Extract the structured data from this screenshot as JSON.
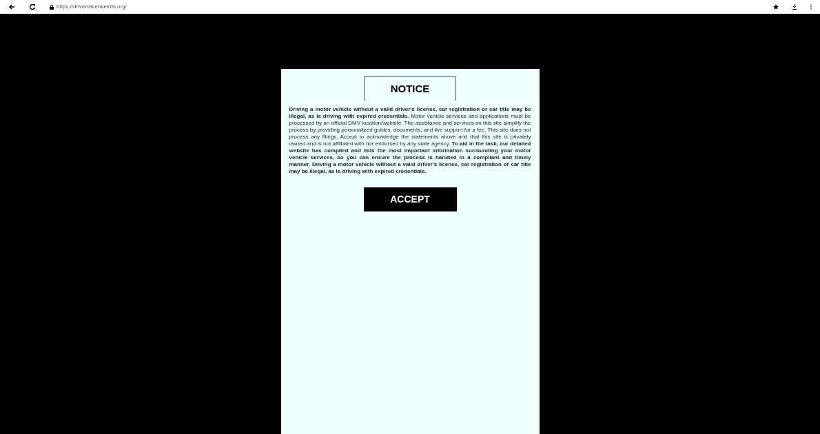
{
  "browser": {
    "url": "https://driverslicenseinfo.org/"
  },
  "notice": {
    "title": "NOTICE",
    "body": "**Driving a motor vehicle without a valid driver's license, car registration or car title may be illegal, as is driving with expired credentials.** Motor vehicle services and applications must be processed by an official DMV location/website. The assistance and services on this site simplify the process by providing personalized guides, documents, and live support for a fee. This site does not process any filings. Accept to acknowledge the statements above and that this site is privately owned and is not affiliated with nor endorsed by any state agency. **To aid in the task, our detailed website has compiled and lists the most important information surrounding your motor vehicle services, so you can ensure the process is handled in a compliant and timely manner. Driving a motor vehicle without a valid driver's license, car registration or car title may be illegal, as is driving with expired credentials.**",
    "button": "ACCEPT"
  }
}
